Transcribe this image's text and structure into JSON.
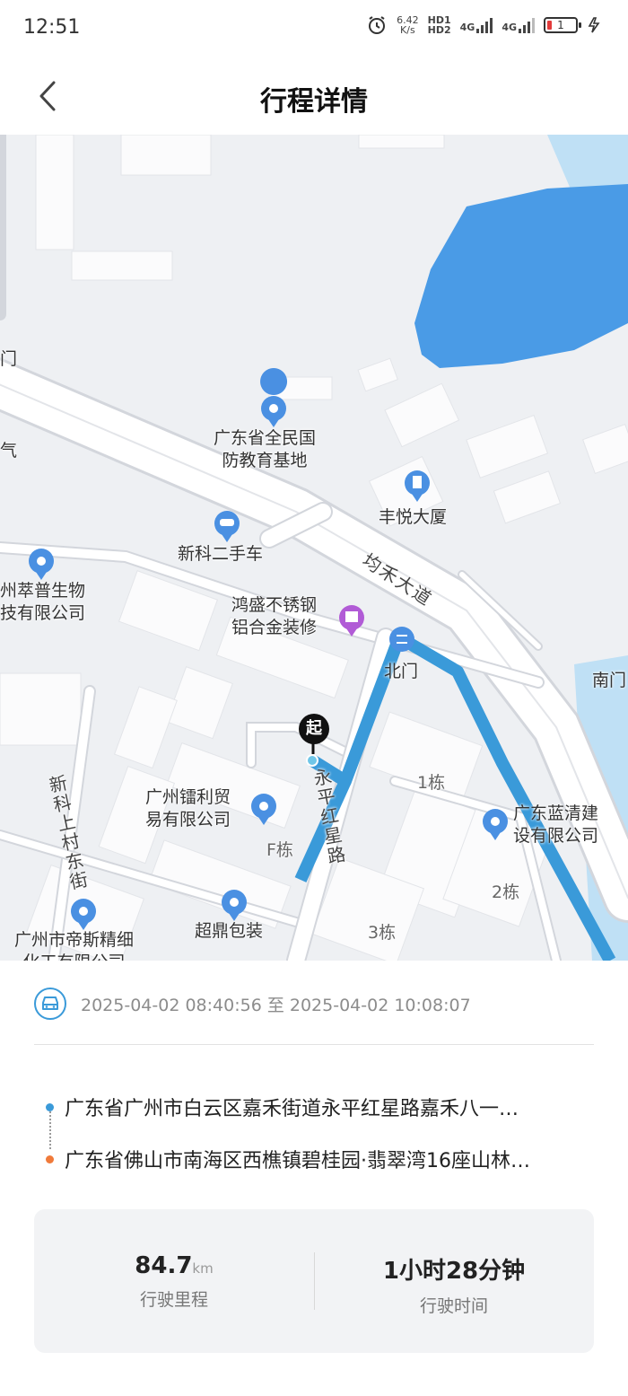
{
  "status_bar": {
    "time": "12:51",
    "net_speed": "6.42",
    "net_unit": "K/s",
    "hd1": "HD1",
    "hd2": "HD2",
    "sig1": "4G",
    "sig2": "4G",
    "battery": "1"
  },
  "header": {
    "title": "行程详情",
    "back_icon": "chevron-left-icon"
  },
  "map": {
    "labels": {
      "men_left": "门",
      "qi_left": "气",
      "base": "广东省全民国\n防教育基地",
      "fengyue": "丰悦大厦",
      "xinke_car": "新科二手车",
      "junhe_road": "均禾大道",
      "cuipu": "州萃普生物\n技有限公司",
      "hongsheng": "鸿盛不锈钢\n铝合金装修",
      "beimen": "北门",
      "nanmen": "南门",
      "guangzhou_lili": "广州镭利贸\n易有限公司",
      "building_1": "1栋",
      "lanqing": "广东蓝清建\n设有限公司",
      "building_f": "F栋",
      "yongping_road": "永平红星路",
      "xinke_street": "新科上村东街",
      "building_2": "2栋",
      "chaoding": "超鼎包装",
      "building_3": "3栋",
      "disi": "广州市帝斯精细\n化工有限公司"
    },
    "start_badge": "起",
    "route_color": "#3a9ad9",
    "water_color": "#4a9be6"
  },
  "trip": {
    "time_range": "2025-04-02 08:40:56 至 2025-04-02 10:08:07",
    "start_address": "广东省广州市白云区嘉禾街道永平红星路嘉禾八一…",
    "end_address": "广东省佛山市南海区西樵镇碧桂园·翡翠湾16座山林…",
    "start_color": "#3a9ad9",
    "end_color": "#f07a3a"
  },
  "stats": {
    "distance_value": "84.7",
    "distance_unit": "km",
    "distance_label": "行驶里程",
    "duration_value": "1小时28分钟",
    "duration_label": "行驶时间"
  }
}
